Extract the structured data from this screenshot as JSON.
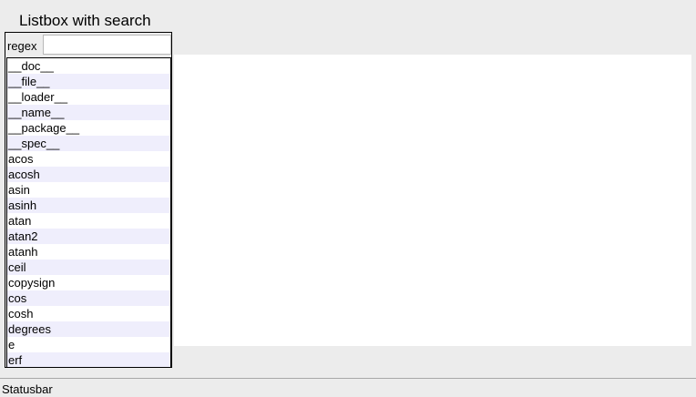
{
  "window": {
    "title": "Listbox with search"
  },
  "search": {
    "label": "regex",
    "value": "",
    "placeholder": ""
  },
  "listbox": {
    "items": [
      "__doc__",
      "__file__",
      "__loader__",
      "__name__",
      "__package__",
      "__spec__",
      "acos",
      "acosh",
      "asin",
      "asinh",
      "atan",
      "atan2",
      "atanh",
      "ceil",
      "copysign",
      "cos",
      "cosh",
      "degrees",
      "e",
      "erf"
    ]
  },
  "statusbar": {
    "text": "Statusbar"
  },
  "colors": {
    "window_background": "#ececec",
    "list_alt_row": "#efeefc",
    "content_background": "#ffffff"
  }
}
